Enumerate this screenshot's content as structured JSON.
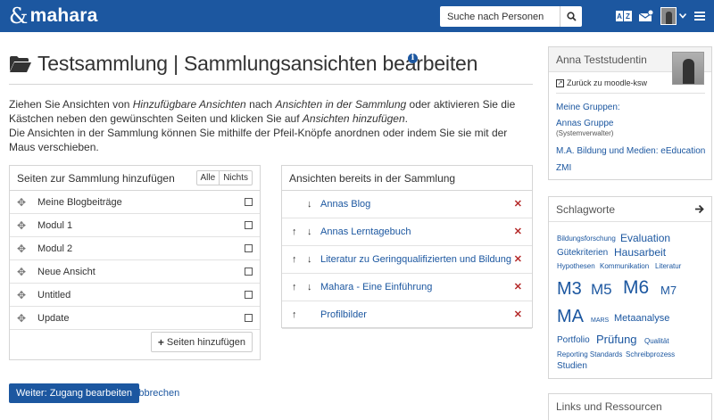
{
  "header": {
    "logo_text": "mahara",
    "search_placeholder": "Suche nach Personen",
    "icons": [
      "mahara-logo-icon",
      "search-icon",
      "language-icon",
      "inbox-icon",
      "avatar-icon",
      "chevron-down-icon",
      "hamburger-menu-icon"
    ]
  },
  "page": {
    "title": "Testsammlung | Sammlungsansichten bearbeiten",
    "description": {
      "p1_a": "Ziehen Sie Ansichten von ",
      "p1_b": "Hinzufügbare Ansichten",
      "p1_c": " nach ",
      "p1_d": "Ansichten in der Sammlung",
      "p1_e": " oder aktivieren Sie die Kästchen neben den gewünschten Seiten und klicken Sie auf ",
      "p1_f": "Ansichten hinzufügen",
      "p1_g": ".",
      "p2": "Die Ansichten in der Sammlung können Sie mithilfe der Pfeil-Knöpfe anordnen oder indem Sie sie mit der Maus verschieben."
    }
  },
  "add_panel": {
    "title": "Seiten zur Sammlung hinzufügen",
    "all_label": "Alle",
    "none_label": "Nichts",
    "items": [
      {
        "label": "Meine Blogbeiträge"
      },
      {
        "label": "Modul 1"
      },
      {
        "label": "Modul 2"
      },
      {
        "label": "Neue Ansicht"
      },
      {
        "label": "Untitled"
      },
      {
        "label": "Update"
      }
    ],
    "add_button": "Seiten hinzufügen"
  },
  "collection_panel": {
    "title": "Ansichten bereits in der Sammlung",
    "items": [
      {
        "label": "Annas Blog",
        "up": false,
        "down": true
      },
      {
        "label": "Annas Lerntagebuch",
        "up": true,
        "down": true
      },
      {
        "label": "Literatur zu Geringqualifizierten und Bildung",
        "up": true,
        "down": true
      },
      {
        "label": "Mahara - Eine Einführung",
        "up": true,
        "down": true
      },
      {
        "label": "Profilbilder",
        "up": true,
        "down": false
      }
    ]
  },
  "actions": {
    "next_button": "Weiter: Zugang bearbeiten",
    "cancel_link": "Abbrechen"
  },
  "sidebar": {
    "user": {
      "name": "Anna Teststudentin",
      "back_link": "Zurück zu moodle-ksw",
      "groups_heading": "Meine Gruppen:",
      "groups": [
        {
          "name": "Annas Gruppe",
          "role": "(Systemverwalter)"
        },
        {
          "name": "M.A. Bildung und Medien: eEducation",
          "role": ""
        },
        {
          "name": "ZMI",
          "role": ""
        }
      ]
    },
    "tags": {
      "title": "Schlagworte",
      "items": [
        "Bildungsforschung",
        "Evaluation",
        "Gütekriterien",
        "Hausarbeit",
        "Hypothesen",
        "Kommunikation",
        "Literatur",
        "M3",
        "M5",
        "M6",
        "M7",
        "MA",
        "MARS",
        "Metaanalyse",
        "Portfolio",
        "Prüfung",
        "Qualität",
        "Reporting Standards",
        "Schreibprozess",
        "Studien"
      ]
    },
    "links": {
      "title": "Links und Ressourcen"
    }
  },
  "colors": {
    "brand": "#1c57a0",
    "remove": "#b52b2b"
  }
}
